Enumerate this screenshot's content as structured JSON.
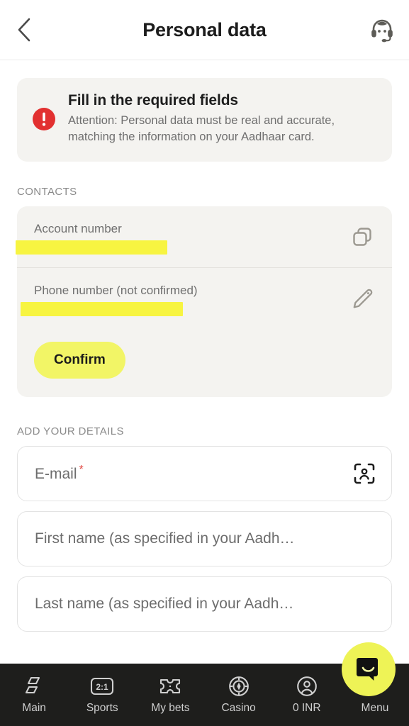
{
  "header": {
    "title": "Personal data",
    "back_icon": "chevron-left-icon",
    "support_icon": "headset-support-icon"
  },
  "alert": {
    "icon": "error-exclamation-icon",
    "title": "Fill in the required fields",
    "description": "Attention: Personal data must be real and accurate, matching the information on your Aadhaar card.",
    "icon_color": "#e23030"
  },
  "contacts": {
    "section_label": "CONTACTS",
    "rows": [
      {
        "label": "Account number",
        "value": "",
        "redacted": true,
        "action_icon": "copy-icon"
      },
      {
        "label": "Phone number (not confirmed)",
        "value": "",
        "redacted": true,
        "action_icon": "pencil-edit-icon"
      }
    ],
    "confirm_label": "Confirm",
    "confirm_color": "#f2f566",
    "card_color": "#f4f3f0"
  },
  "details": {
    "section_label": "ADD YOUR DETAILS",
    "fields": [
      {
        "placeholder": "E-mail",
        "required": true,
        "required_marker": "*",
        "value": "",
        "action_icon": "person-scan-icon"
      },
      {
        "placeholder": "First name (as specified in your Aadh…",
        "required": false,
        "value": "",
        "action_icon": ""
      },
      {
        "placeholder": "Last name (as specified in your Aadh…",
        "required": false,
        "value": "",
        "action_icon": ""
      }
    ]
  },
  "bottom_nav": {
    "background": "#1e1e1c",
    "items": [
      {
        "label": "Main",
        "icon": "rhombus-stack-icon"
      },
      {
        "label": "Sports",
        "icon": "scoreboard-2-1-icon"
      },
      {
        "label": "My bets",
        "icon": "ticket-icon"
      },
      {
        "label": "Casino",
        "icon": "poker-chip-icon"
      },
      {
        "label": "0 INR",
        "icon": "account-circle-icon"
      },
      {
        "label": "Menu",
        "icon": "menu-icon"
      }
    ]
  },
  "chat_fab": {
    "icon": "chat-bubble-smile-icon",
    "color": "#eef356"
  }
}
